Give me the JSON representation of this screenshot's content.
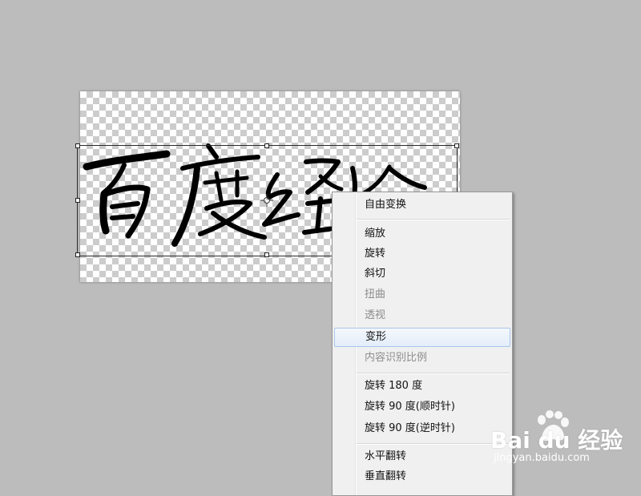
{
  "canvas": {
    "artwork": "百度经验"
  },
  "context_menu": {
    "items": [
      {
        "label": "自由变换",
        "disabled": false
      },
      {
        "label": "缩放",
        "disabled": false
      },
      {
        "label": "旋转",
        "disabled": false
      },
      {
        "label": "斜切",
        "disabled": false
      },
      {
        "label": "扭曲",
        "disabled": true
      },
      {
        "label": "透视",
        "disabled": true
      },
      {
        "label": "变形",
        "disabled": false,
        "highlighted": true
      },
      {
        "label": "内容识别比例",
        "disabled": true
      },
      {
        "label": "旋转 180 度",
        "disabled": false
      },
      {
        "label": "旋转 90 度(顺时针)",
        "disabled": false
      },
      {
        "label": "旋转 90 度(逆时针)",
        "disabled": false
      },
      {
        "label": "水平翻转",
        "disabled": false
      },
      {
        "label": "垂直翻转",
        "disabled": false
      }
    ]
  },
  "watermark": {
    "brand": "Bai du 经验",
    "url": "jingyan.baidu.com"
  },
  "colors": {
    "workspace": "#bcbcbc",
    "menu_bg": "#f0f0f0",
    "hover_border": "#a9c7ea"
  }
}
